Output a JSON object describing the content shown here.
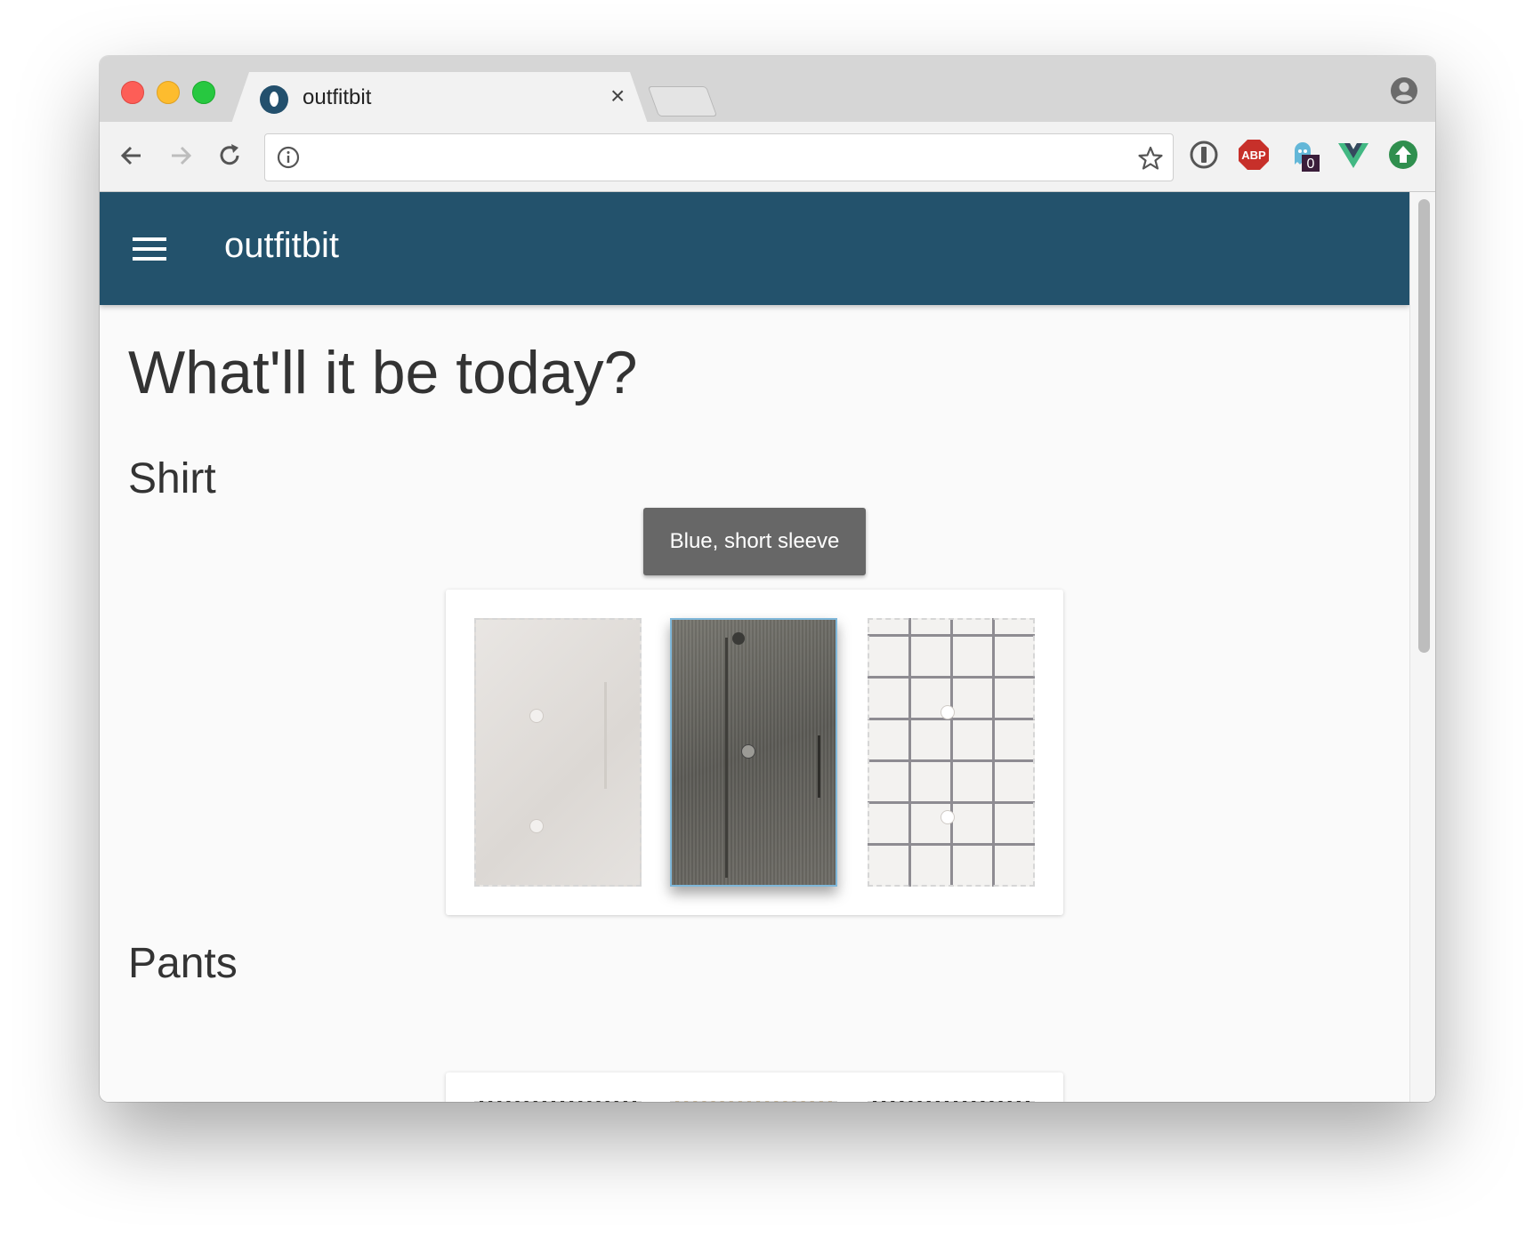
{
  "browser": {
    "tab_title": "outfitbit",
    "close_glyph": "×",
    "address_value": "",
    "icons": [
      "back-icon",
      "forward-icon",
      "reload-icon",
      "site-info-icon",
      "bookmark-star-icon",
      "profile-icon"
    ],
    "extensions": [
      "password-manager-icon",
      "adblock-plus-icon",
      "ghostery-icon",
      "vue-devtools-icon",
      "upload-extension-icon"
    ],
    "adblock_label": "ABP",
    "ghostery_badge": "0"
  },
  "app": {
    "title": "outfitbit",
    "appbar_color": "#23526c",
    "heading": "What'll it be today?"
  },
  "sections": {
    "shirt": {
      "title": "Shirt",
      "tooltip": "Blue, short sleeve",
      "items": [
        {
          "name": "white-shirt",
          "selected": false
        },
        {
          "name": "grey-shirt",
          "selected": true
        },
        {
          "name": "check-shirt",
          "selected": false
        }
      ]
    },
    "pants": {
      "title": "Pants",
      "items": [
        {
          "name": "pants-1",
          "selected": false
        },
        {
          "name": "pants-2",
          "selected": false
        },
        {
          "name": "pants-3",
          "selected": false
        }
      ]
    }
  }
}
